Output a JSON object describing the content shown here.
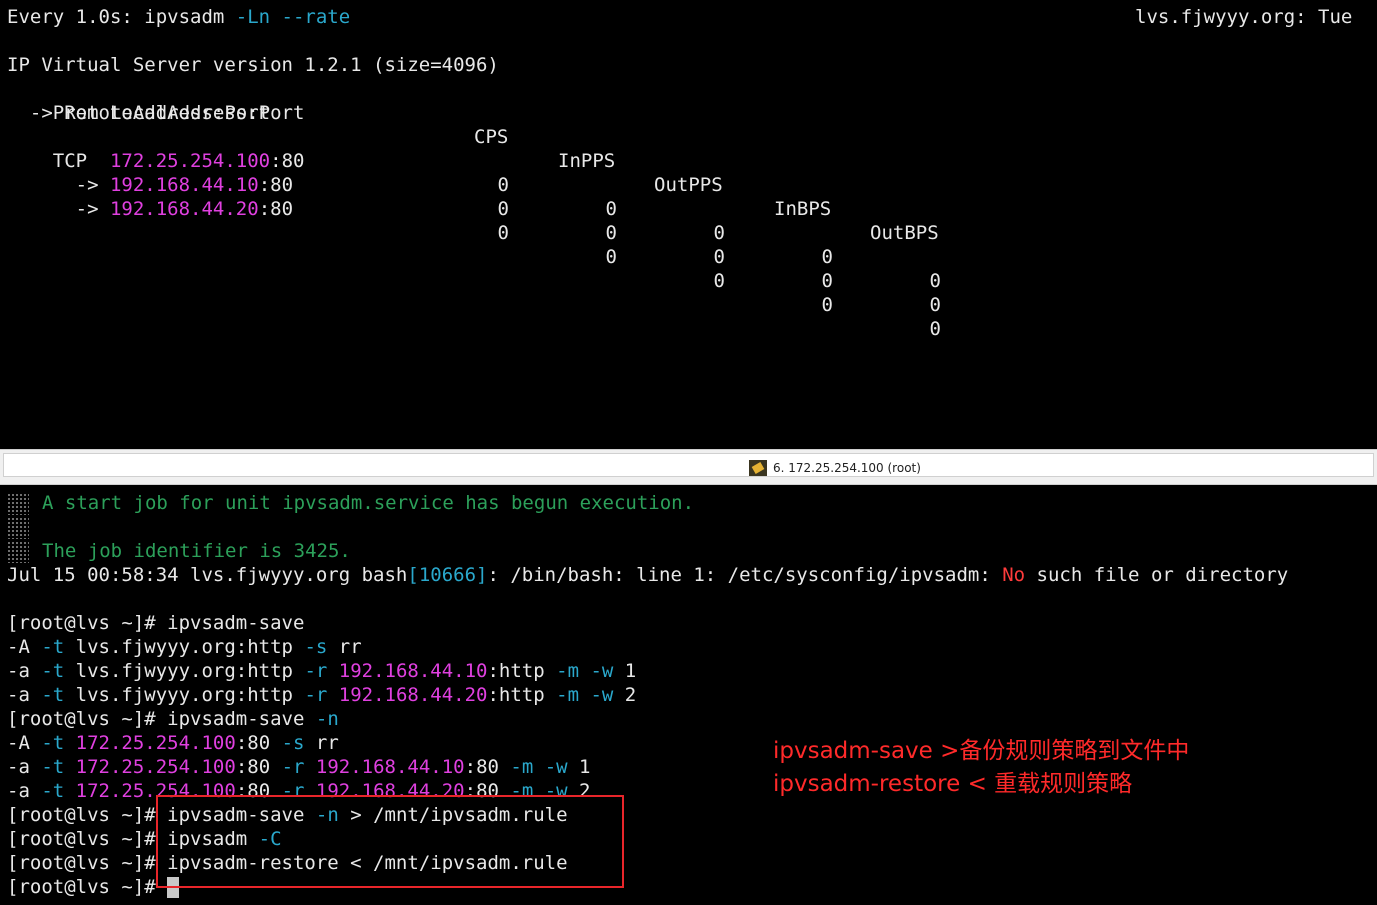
{
  "top": {
    "watch_prefix": "Every 1.0s: ipvsadm ",
    "watch_args": "-Ln --rate",
    "watch_host": "lvs.fjwyyy.org: Tue",
    "version_line": "IP Virtual Server version 1.2.1 (size=4096)",
    "header_left": "Prot LocalAddress:Port",
    "header_cols": [
      "CPS",
      "InPPS",
      "OutPPS",
      "InBPS",
      "OutBPS"
    ],
    "remote_header": "  -> RemoteAddress:Port",
    "rows": [
      {
        "prefix": "TCP  ",
        "ip": "172.25.254.100",
        "port": ":80",
        "values": [
          "0",
          "0",
          "0",
          "0",
          "0"
        ]
      },
      {
        "prefix": "  -> ",
        "ip": "192.168.44.10",
        "port": ":80",
        "values": [
          "0",
          "0",
          "0",
          "0",
          "0"
        ]
      },
      {
        "prefix": "  -> ",
        "ip": "192.168.44.20",
        "port": ":80",
        "values": [
          "0",
          "0",
          "0",
          "0",
          "0"
        ]
      }
    ]
  },
  "tab": {
    "label": "6. 172.25.254.100 (root)"
  },
  "bottom": {
    "msg1": "A start job for unit ipvsadm.service has begun execution.",
    "msg2": "The job identifier is 3425.",
    "err_pre": "Jul 15 00:58:34 lvs.fjwyyy.org bash",
    "err_pid": "[10666]",
    "err_mid": ": /bin/bash: line 1: /etc/sysconfig/ipvsadm: ",
    "err_no": "No",
    "err_post": " such file or directory",
    "prompt": "[root@lvs ~]# ",
    "cmd_save": "ipvsadm-save",
    "cmd_save_n": "ipvsadm-save ",
    "flag_n": "-n",
    "save1": [
      {
        "a": "-A ",
        "t": "-t",
        "host": " lvs.fjwyyy.org:http ",
        "f": "-s",
        "rest": " rr"
      },
      {
        "a": "-a ",
        "t": "-t",
        "host": " lvs.fjwyyy.org:http ",
        "f": "-r",
        "ip": " 192.168.44.10",
        "port": ":http ",
        "m": "-m",
        "w": " -w",
        "wv": " 1"
      },
      {
        "a": "-a ",
        "t": "-t",
        "host": " lvs.fjwyyy.org:http ",
        "f": "-r",
        "ip": " 192.168.44.20",
        "port": ":http ",
        "m": "-m",
        "w": " -w",
        "wv": " 2"
      }
    ],
    "save2": [
      {
        "a": "-A ",
        "t": "-t",
        "ip1": " 172.25.254.100",
        "port1": ":80 ",
        "f": "-s",
        "rest": " rr"
      },
      {
        "a": "-a ",
        "t": "-t",
        "ip1": " 172.25.254.100",
        "port1": ":80 ",
        "f": "-r",
        "ip": " 192.168.44.10",
        "port": ":80 ",
        "m": "-m",
        "w": " -w",
        "wv": " 1"
      },
      {
        "a": "-a ",
        "t": "-t",
        "ip1": " 172.25.254.100",
        "port1": ":80 ",
        "f": "-r",
        "ip": " 192.168.44.20",
        "port": ":80 ",
        "m": "-m",
        "w": " -w",
        "wv": " 2"
      }
    ],
    "cmd3_rest": " > /mnt/ipvsadm.rule",
    "cmd4": "ipvsadm ",
    "cmd4_flag": "-C",
    "cmd5": "ipvsadm-restore < /mnt/ipvsadm.rule",
    "annotation1": "ipvsadm-save >备份规则策略到文件中",
    "annotation2": "ipvsadm-restore < 重载规则策略"
  },
  "colors": {
    "magenta": "#e040e0",
    "cyan": "#2aa8cc",
    "green": "#2ca05a",
    "red": "#ff3b3b",
    "highlight_box": "#e8252a"
  }
}
